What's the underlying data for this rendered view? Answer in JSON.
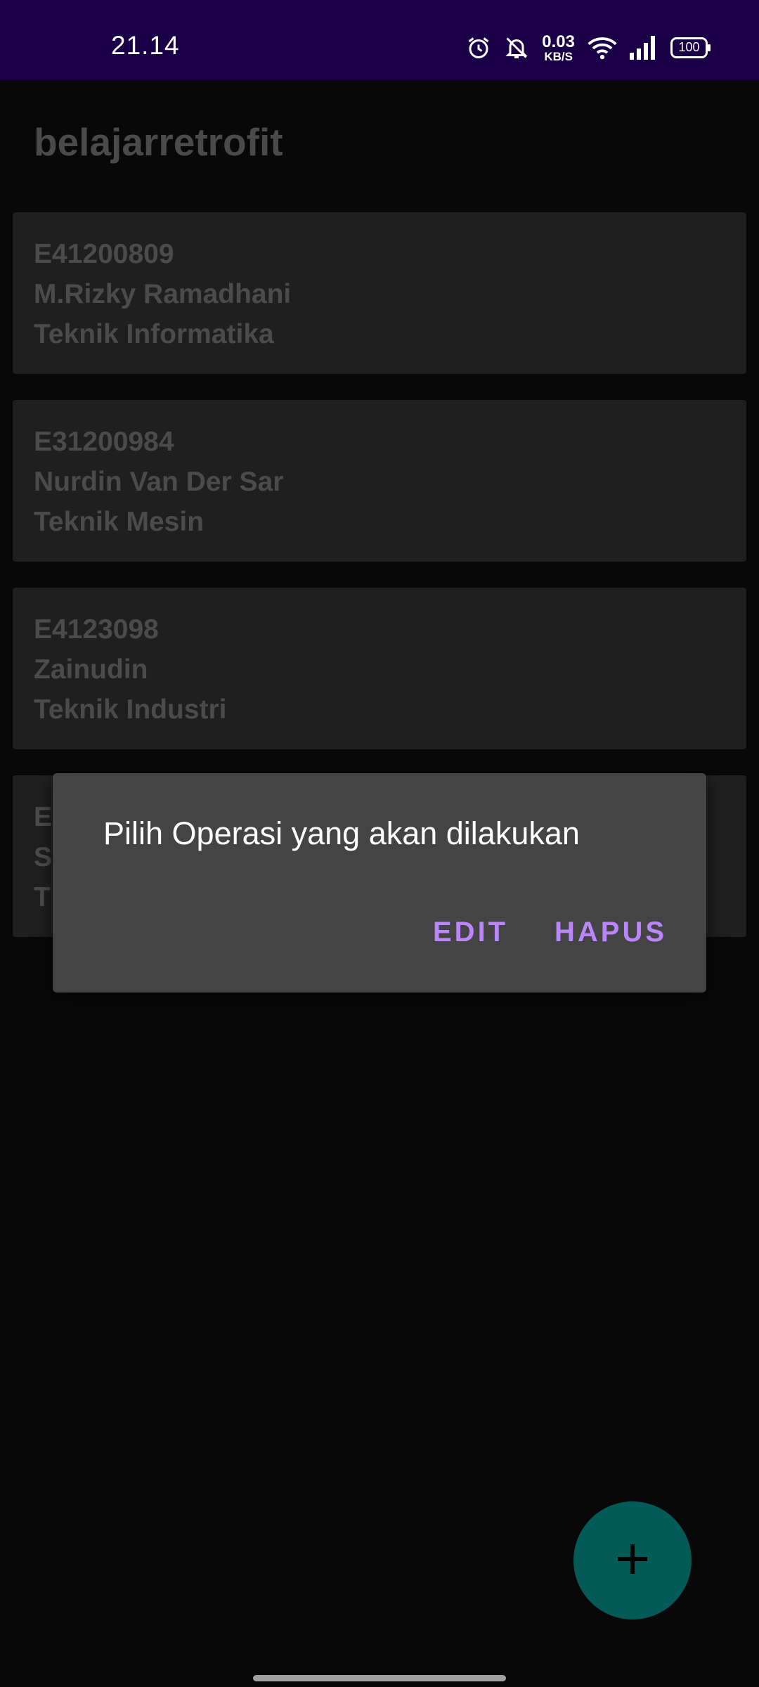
{
  "status_bar": {
    "time": "21.14",
    "net_speed_value": "0.03",
    "net_speed_unit": "KB/S",
    "battery": "100",
    "icons": [
      "alarm-icon",
      "notifications-off-icon",
      "wifi-icon",
      "signal-icon",
      "battery-icon"
    ]
  },
  "app_bar": {
    "title": "belajarretrofit"
  },
  "list": {
    "items": [
      {
        "id": "E41200809",
        "name": "M.Rizky Ramadhani",
        "department": "Teknik Informatika"
      },
      {
        "id": "E31200984",
        "name": "Nurdin Van Der Sar",
        "department": "Teknik Mesin"
      },
      {
        "id": "E4123098",
        "name": "Zainudin",
        "department": "Teknik Industri"
      },
      {
        "id": "E",
        "name": "S",
        "department": "T"
      }
    ]
  },
  "dialog": {
    "message": "Pilih Operasi yang akan dilakukan",
    "edit_label": "EDIT",
    "delete_label": "HAPUS"
  },
  "fab": {
    "icon": "plus-icon"
  },
  "colors": {
    "status_bar": "#1a0046",
    "background": "#080808",
    "card": "#1f1f1f",
    "dialog": "#444444",
    "accent": "#bb86fc",
    "fab": "#025b56"
  }
}
